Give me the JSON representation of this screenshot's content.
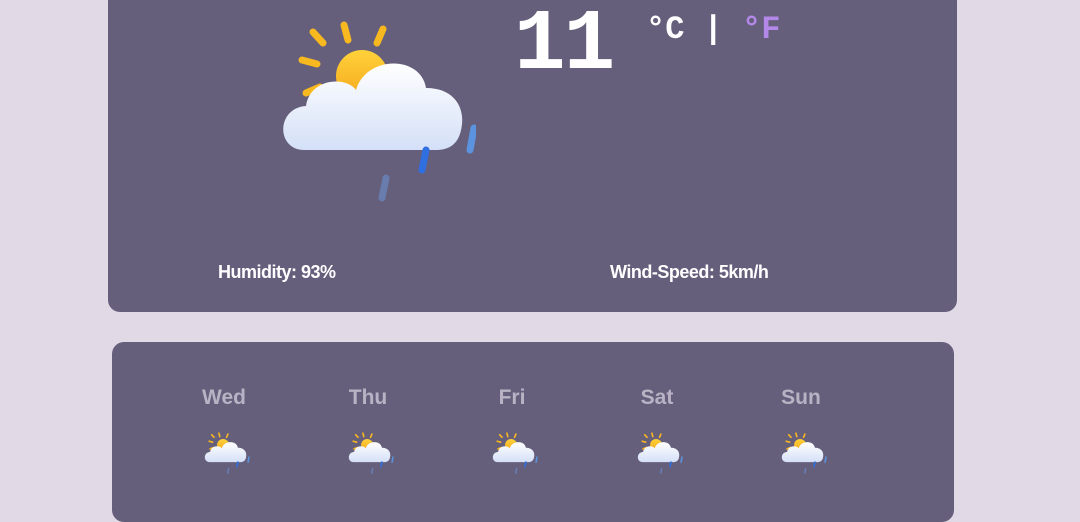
{
  "current": {
    "temperature": "11",
    "unit_c": "°C",
    "unit_separator": " | ",
    "unit_f": "°F",
    "humidity_label": "Humidity: 93%",
    "wind_label": "Wind-Speed: 5km/h",
    "icon": "sun-cloud-rain-icon"
  },
  "forecast": [
    {
      "day": "Wed",
      "icon": "sun-cloud-rain-icon"
    },
    {
      "day": "Thu",
      "icon": "sun-cloud-rain-icon"
    },
    {
      "day": "Fri",
      "icon": "sun-cloud-rain-icon"
    },
    {
      "day": "Sat",
      "icon": "sun-cloud-rain-icon"
    },
    {
      "day": "Sun",
      "icon": "sun-cloud-rain-icon"
    }
  ],
  "colors": {
    "background": "#e1d9e6",
    "card": "#655f7c",
    "accent_unit_f": "#b388e8",
    "day_label": "#b8b3c4"
  }
}
